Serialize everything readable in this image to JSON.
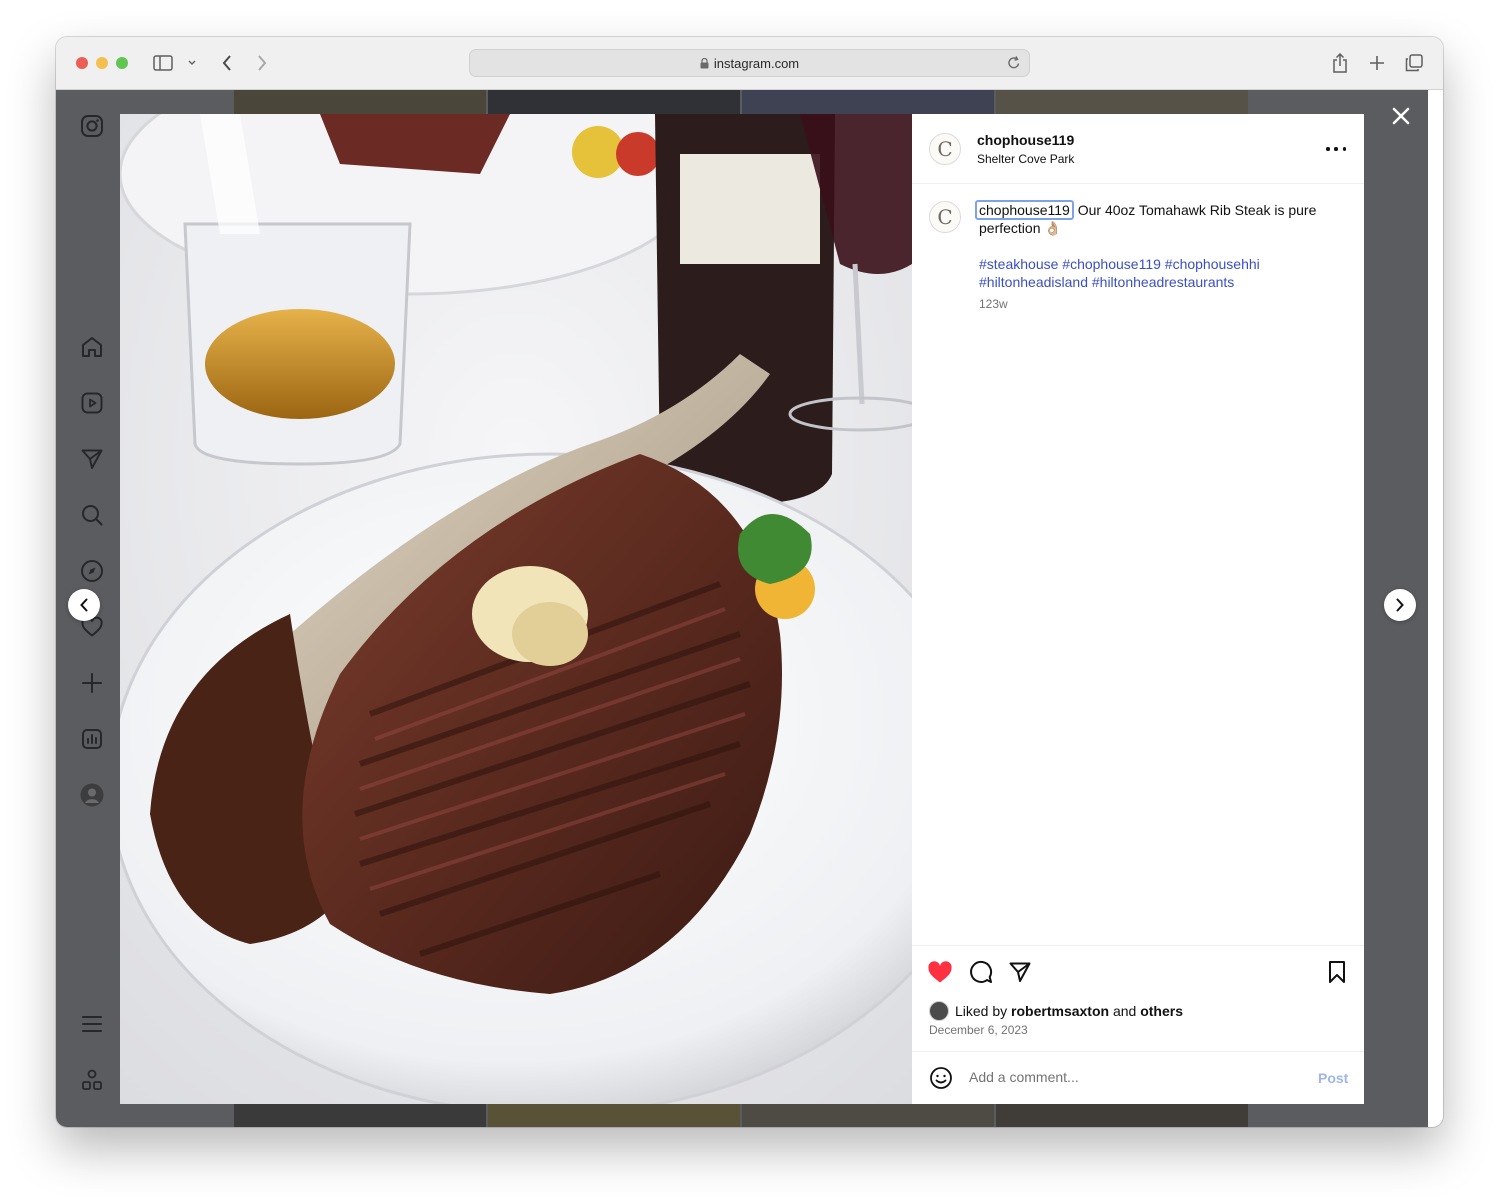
{
  "browser": {
    "url": "instagram.com"
  },
  "post": {
    "author": {
      "username": "chophouse119",
      "location": "Shelter Cove Park",
      "avatar_letter": "C"
    },
    "caption": {
      "username": "chophouse119",
      "text": "Our 40oz Tomahawk Rib Steak is pure perfection 👌🏼",
      "hashtags": "#steakhouse #chophouse119 #chophousehhi #hiltonheadisland #hiltonheadrestaurants",
      "age": "123w"
    },
    "likes": {
      "prefix": "Liked by",
      "user": "robertmsaxton",
      "conjunction": "and",
      "others": "others"
    },
    "date": "December 6, 2023",
    "comment": {
      "placeholder": "Add a comment...",
      "post_label": "Post"
    }
  },
  "sidebar": {
    "icons": [
      "instagram-logo",
      "home",
      "reels",
      "messages",
      "search",
      "explore",
      "notifications",
      "create",
      "insights",
      "profile",
      "menu",
      "more-apps"
    ]
  },
  "colors": {
    "like_red": "#ff3040",
    "hashtag_blue": "#3b4fc4",
    "post_disabled": "#9fb6ec",
    "backdrop": "#5b5c60"
  }
}
